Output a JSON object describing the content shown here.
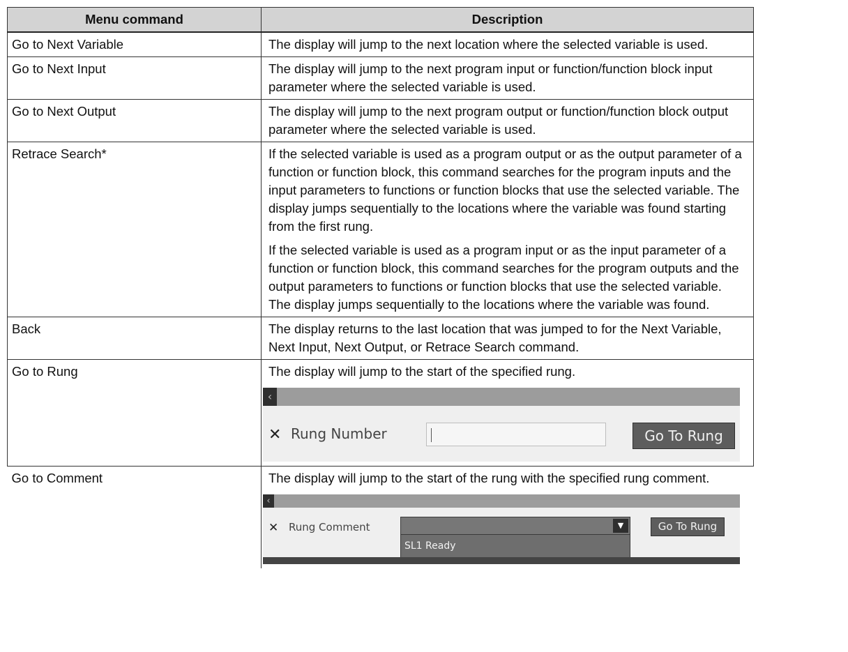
{
  "table": {
    "headers": [
      "Menu command",
      "Description"
    ],
    "rows": [
      {
        "command": "Go to Next Variable",
        "desc": [
          "The display will jump to the next location where the selected variable is used."
        ]
      },
      {
        "command": "Go to Next Input",
        "desc": [
          "The display will jump to the next program input or function/function block input parameter where the selected variable is used."
        ]
      },
      {
        "command": "Go to Next Output",
        "desc": [
          "The display will jump to the next program output or function/function block output parameter where the selected variable is used."
        ]
      },
      {
        "command": "Retrace Search*",
        "desc": [
          "If the selected variable is used as a program output or as the output parameter of a function or function block, this command searches for the program inputs and the input parameters to functions or function blocks that use the selected variable. The display jumps sequentially to the locations where the variable was found starting from the first rung.",
          "If the selected variable is used as a program input or as the input parameter of a function or function block, this command searches for the program outputs and the output parameters to functions or function blocks that use the selected variable. The display jumps sequentially to the locations where the variable was found."
        ]
      },
      {
        "command": "Back",
        "desc": [
          "The display returns to the last location that was jumped to for the Next Variable, Next Input, Next Output, or Retrace Search command."
        ]
      },
      {
        "command": "Go to Rung",
        "desc": [
          "The display will jump to the start of the specified rung."
        ]
      },
      {
        "command": "Go to Comment",
        "desc": [
          "The display will jump to the start of the rung with the specified rung comment."
        ]
      }
    ]
  },
  "goto_rung_dialog": {
    "back_icon": "chevron-left-icon",
    "close_icon": "close-icon",
    "field_label": "Rung Number",
    "field_value": "",
    "button_label": "Go To Rung"
  },
  "goto_comment_dialog": {
    "back_icon": "chevron-left-icon",
    "close_icon": "close-icon",
    "field_label": "Rung Comment",
    "selected_value": "",
    "dropdown_icon": "triangle-down-icon",
    "options": [
      "SL1 Ready"
    ],
    "button_label": "Go To Rung"
  }
}
